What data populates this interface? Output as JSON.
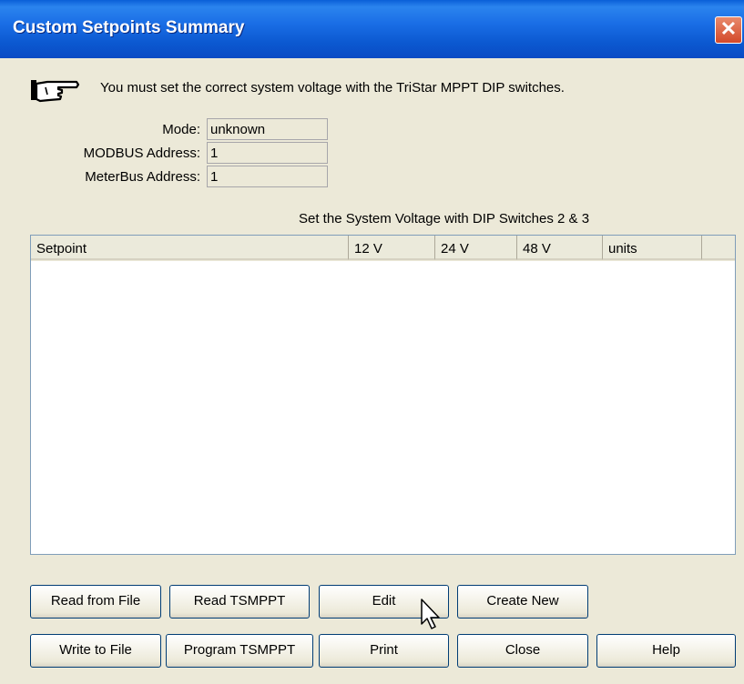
{
  "window": {
    "title": "Custom Setpoints Summary",
    "close_glyph": "✕"
  },
  "notice": {
    "icon": "pointing-hand-icon",
    "text": "You must set the correct system voltage with the TriStar MPPT DIP switches."
  },
  "fields": [
    {
      "label": "Mode:",
      "value": "unknown"
    },
    {
      "label": "MODBUS Address:",
      "value": "1"
    },
    {
      "label": "MeterBus Address:",
      "value": "1"
    }
  ],
  "table": {
    "caption": "Set the System Voltage with DIP Switches 2 & 3",
    "columns": [
      "Setpoint",
      "12 V",
      "24 V",
      "48 V",
      "units"
    ],
    "rows": []
  },
  "buttons": {
    "read_from_file": "Read from File",
    "read_tsmppt": "Read TSMPPT",
    "edit": "Edit",
    "create_new": "Create New",
    "write_to_file": "Write to File",
    "program_tsmppt": "Program TSMPPT",
    "print": "Print",
    "close": "Close",
    "help": "Help"
  }
}
